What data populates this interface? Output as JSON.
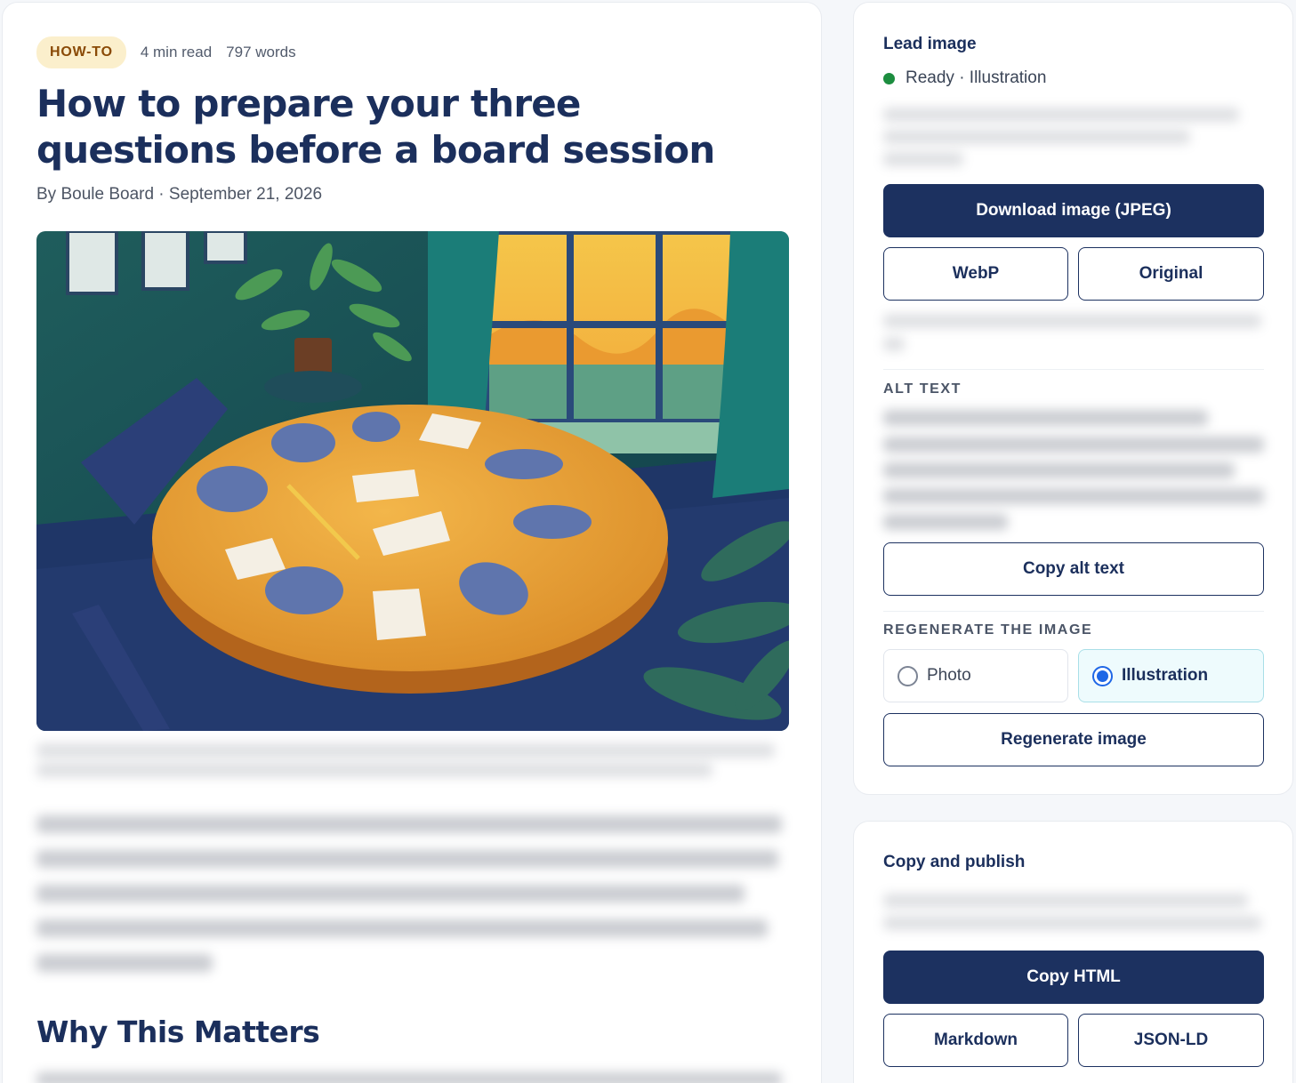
{
  "article": {
    "tag": "HOW-TO",
    "read_time": "4 min read",
    "word_count": "797 words",
    "title": "How to prepare your three questions before a board session",
    "byline": "By Boule Board · September 21, 2026",
    "section_heading": "Why This Matters"
  },
  "lead_image": {
    "title": "Lead image",
    "status": "Ready · Illustration",
    "status_color": "#1c8d3f",
    "download_label": "Download image (JPEG)",
    "webp_label": "WebP",
    "original_label": "Original",
    "alt_text_heading": "ALT TEXT",
    "copy_alt_label": "Copy alt text",
    "regenerate_heading": "REGENERATE THE IMAGE",
    "style_options": [
      {
        "label": "Photo",
        "selected": false
      },
      {
        "label": "Illustration",
        "selected": true
      }
    ],
    "regenerate_label": "Regenerate image"
  },
  "publish": {
    "title": "Copy and publish",
    "copy_html_label": "Copy HTML",
    "markdown_label": "Markdown",
    "jsonld_label": "JSON-LD"
  },
  "colors": {
    "primary": "#1c3160",
    "tag_bg": "#fbefcc",
    "tag_text": "#8a4a06",
    "radio_selected": "#1f67e6"
  }
}
